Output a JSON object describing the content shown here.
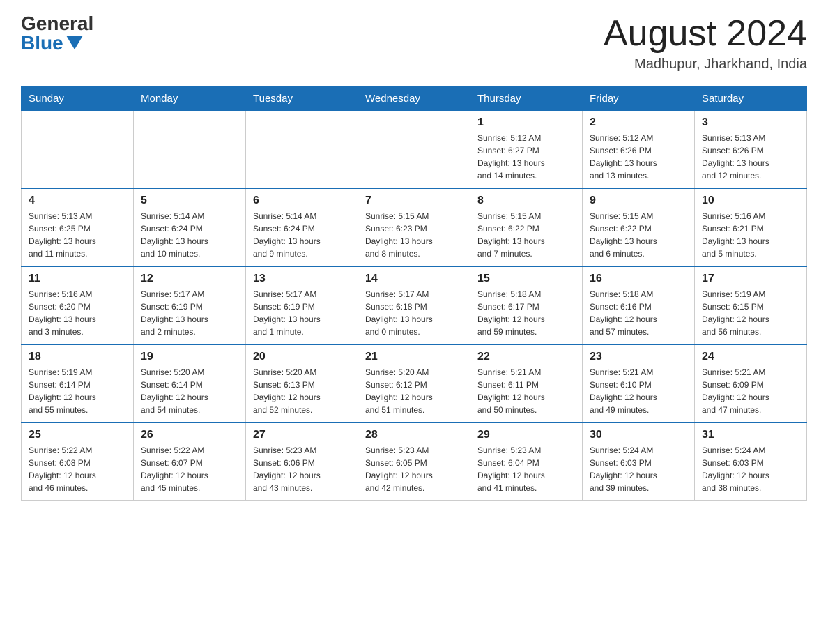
{
  "header": {
    "logo_general": "General",
    "logo_blue": "Blue",
    "month_title": "August 2024",
    "location": "Madhupur, Jharkhand, India"
  },
  "days_of_week": [
    "Sunday",
    "Monday",
    "Tuesday",
    "Wednesday",
    "Thursday",
    "Friday",
    "Saturday"
  ],
  "weeks": [
    [
      {
        "day": "",
        "info": ""
      },
      {
        "day": "",
        "info": ""
      },
      {
        "day": "",
        "info": ""
      },
      {
        "day": "",
        "info": ""
      },
      {
        "day": "1",
        "info": "Sunrise: 5:12 AM\nSunset: 6:27 PM\nDaylight: 13 hours\nand 14 minutes."
      },
      {
        "day": "2",
        "info": "Sunrise: 5:12 AM\nSunset: 6:26 PM\nDaylight: 13 hours\nand 13 minutes."
      },
      {
        "day": "3",
        "info": "Sunrise: 5:13 AM\nSunset: 6:26 PM\nDaylight: 13 hours\nand 12 minutes."
      }
    ],
    [
      {
        "day": "4",
        "info": "Sunrise: 5:13 AM\nSunset: 6:25 PM\nDaylight: 13 hours\nand 11 minutes."
      },
      {
        "day": "5",
        "info": "Sunrise: 5:14 AM\nSunset: 6:24 PM\nDaylight: 13 hours\nand 10 minutes."
      },
      {
        "day": "6",
        "info": "Sunrise: 5:14 AM\nSunset: 6:24 PM\nDaylight: 13 hours\nand 9 minutes."
      },
      {
        "day": "7",
        "info": "Sunrise: 5:15 AM\nSunset: 6:23 PM\nDaylight: 13 hours\nand 8 minutes."
      },
      {
        "day": "8",
        "info": "Sunrise: 5:15 AM\nSunset: 6:22 PM\nDaylight: 13 hours\nand 7 minutes."
      },
      {
        "day": "9",
        "info": "Sunrise: 5:15 AM\nSunset: 6:22 PM\nDaylight: 13 hours\nand 6 minutes."
      },
      {
        "day": "10",
        "info": "Sunrise: 5:16 AM\nSunset: 6:21 PM\nDaylight: 13 hours\nand 5 minutes."
      }
    ],
    [
      {
        "day": "11",
        "info": "Sunrise: 5:16 AM\nSunset: 6:20 PM\nDaylight: 13 hours\nand 3 minutes."
      },
      {
        "day": "12",
        "info": "Sunrise: 5:17 AM\nSunset: 6:19 PM\nDaylight: 13 hours\nand 2 minutes."
      },
      {
        "day": "13",
        "info": "Sunrise: 5:17 AM\nSunset: 6:19 PM\nDaylight: 13 hours\nand 1 minute."
      },
      {
        "day": "14",
        "info": "Sunrise: 5:17 AM\nSunset: 6:18 PM\nDaylight: 13 hours\nand 0 minutes."
      },
      {
        "day": "15",
        "info": "Sunrise: 5:18 AM\nSunset: 6:17 PM\nDaylight: 12 hours\nand 59 minutes."
      },
      {
        "day": "16",
        "info": "Sunrise: 5:18 AM\nSunset: 6:16 PM\nDaylight: 12 hours\nand 57 minutes."
      },
      {
        "day": "17",
        "info": "Sunrise: 5:19 AM\nSunset: 6:15 PM\nDaylight: 12 hours\nand 56 minutes."
      }
    ],
    [
      {
        "day": "18",
        "info": "Sunrise: 5:19 AM\nSunset: 6:14 PM\nDaylight: 12 hours\nand 55 minutes."
      },
      {
        "day": "19",
        "info": "Sunrise: 5:20 AM\nSunset: 6:14 PM\nDaylight: 12 hours\nand 54 minutes."
      },
      {
        "day": "20",
        "info": "Sunrise: 5:20 AM\nSunset: 6:13 PM\nDaylight: 12 hours\nand 52 minutes."
      },
      {
        "day": "21",
        "info": "Sunrise: 5:20 AM\nSunset: 6:12 PM\nDaylight: 12 hours\nand 51 minutes."
      },
      {
        "day": "22",
        "info": "Sunrise: 5:21 AM\nSunset: 6:11 PM\nDaylight: 12 hours\nand 50 minutes."
      },
      {
        "day": "23",
        "info": "Sunrise: 5:21 AM\nSunset: 6:10 PM\nDaylight: 12 hours\nand 49 minutes."
      },
      {
        "day": "24",
        "info": "Sunrise: 5:21 AM\nSunset: 6:09 PM\nDaylight: 12 hours\nand 47 minutes."
      }
    ],
    [
      {
        "day": "25",
        "info": "Sunrise: 5:22 AM\nSunset: 6:08 PM\nDaylight: 12 hours\nand 46 minutes."
      },
      {
        "day": "26",
        "info": "Sunrise: 5:22 AM\nSunset: 6:07 PM\nDaylight: 12 hours\nand 45 minutes."
      },
      {
        "day": "27",
        "info": "Sunrise: 5:23 AM\nSunset: 6:06 PM\nDaylight: 12 hours\nand 43 minutes."
      },
      {
        "day": "28",
        "info": "Sunrise: 5:23 AM\nSunset: 6:05 PM\nDaylight: 12 hours\nand 42 minutes."
      },
      {
        "day": "29",
        "info": "Sunrise: 5:23 AM\nSunset: 6:04 PM\nDaylight: 12 hours\nand 41 minutes."
      },
      {
        "day": "30",
        "info": "Sunrise: 5:24 AM\nSunset: 6:03 PM\nDaylight: 12 hours\nand 39 minutes."
      },
      {
        "day": "31",
        "info": "Sunrise: 5:24 AM\nSunset: 6:03 PM\nDaylight: 12 hours\nand 38 minutes."
      }
    ]
  ]
}
